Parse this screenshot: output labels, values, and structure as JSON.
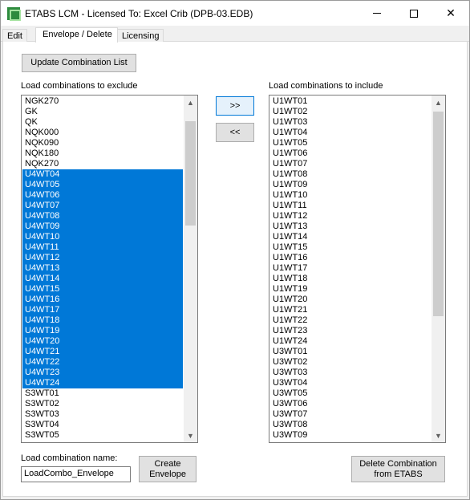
{
  "window": {
    "title": "ETABS LCM  - Licensed To: Excel Crib (DPB-03.EDB)",
    "minimize": "—",
    "close": "✕"
  },
  "tabs": [
    {
      "label": "Edit"
    },
    {
      "label": "Envelope / Delete"
    },
    {
      "label": "Licensing"
    }
  ],
  "active_tab": "Envelope / Delete",
  "buttons": {
    "update": "Update Combination List",
    "add": ">>",
    "remove": "<<",
    "create_line1": "Create",
    "create_line2": "Envelope",
    "delete_line1": "Delete Combination",
    "delete_line2": "from ETABS"
  },
  "exclude": {
    "label": "Load combinations to exclude",
    "items": [
      "NGK270",
      "GK",
      "QK",
      "NQK000",
      "NQK090",
      "NQK180",
      "NQK270",
      "U4WT04",
      "U4WT05",
      "U4WT06",
      "U4WT07",
      "U4WT08",
      "U4WT09",
      "U4WT10",
      "U4WT11",
      "U4WT12",
      "U4WT13",
      "U4WT14",
      "U4WT15",
      "U4WT16",
      "U4WT17",
      "U4WT18",
      "U4WT19",
      "U4WT20",
      "U4WT21",
      "U4WT22",
      "U4WT23",
      "U4WT24",
      "S3WT01",
      "S3WT02",
      "S3WT03",
      "S3WT04",
      "S3WT05"
    ],
    "selected": [
      "U4WT04",
      "U4WT05",
      "U4WT06",
      "U4WT07",
      "U4WT08",
      "U4WT09",
      "U4WT10",
      "U4WT11",
      "U4WT12",
      "U4WT13",
      "U4WT14",
      "U4WT15",
      "U4WT16",
      "U4WT17",
      "U4WT18",
      "U4WT19",
      "U4WT20",
      "U4WT21",
      "U4WT22",
      "U4WT23",
      "U4WT24"
    ]
  },
  "include": {
    "label": "Load combinations to include",
    "items": [
      "U1WT01",
      "U1WT02",
      "U1WT03",
      "U1WT04",
      "U1WT05",
      "U1WT06",
      "U1WT07",
      "U1WT08",
      "U1WT09",
      "U1WT10",
      "U1WT11",
      "U1WT12",
      "U1WT13",
      "U1WT14",
      "U1WT15",
      "U1WT16",
      "U1WT17",
      "U1WT18",
      "U1WT19",
      "U1WT20",
      "U1WT21",
      "U1WT22",
      "U1WT23",
      "U1WT24",
      "U3WT01",
      "U3WT02",
      "U3WT03",
      "U3WT04",
      "U3WT05",
      "U3WT06",
      "U3WT07",
      "U3WT08",
      "U3WT09"
    ]
  },
  "combo_name": {
    "label": "Load combination name:",
    "value": "LoadCombo_Envelope"
  },
  "scroll": {
    "up_icon": "▲",
    "down_icon": "▼"
  },
  "colors": {
    "selection": "#0078d7",
    "focus_border": "#0078d7"
  }
}
